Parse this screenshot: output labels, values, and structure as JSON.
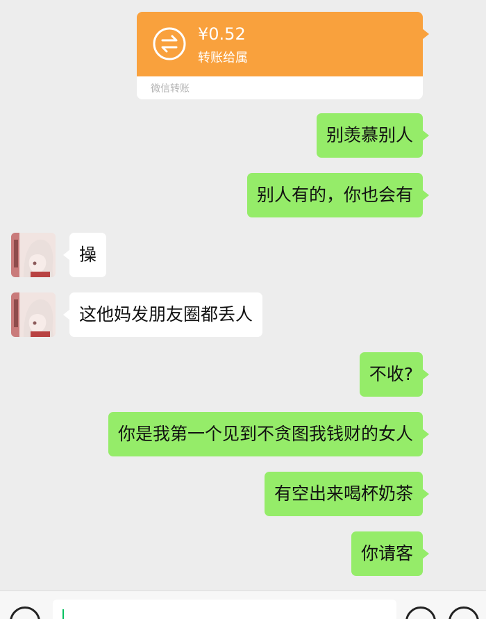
{
  "transfer": {
    "amount": "¥0.52",
    "note": "转账给属",
    "source": "微信转账",
    "icon": "transfer-arrows-icon"
  },
  "messages": [
    {
      "sender": "me",
      "text": "别羡慕别人"
    },
    {
      "sender": "me",
      "text": "别人有的，你也会有"
    },
    {
      "sender": "them",
      "text": "操"
    },
    {
      "sender": "them",
      "text": "这他妈发朋友圈都丢人"
    },
    {
      "sender": "me",
      "text": "不收?"
    },
    {
      "sender": "me",
      "text": "你是我第一个见到不贪图我钱财的女人"
    },
    {
      "sender": "me",
      "text": "有空出来喝杯奶茶"
    },
    {
      "sender": "me",
      "text": "你请客"
    }
  ],
  "input": {
    "value": "",
    "left_icon": "voice-icon",
    "right_icons": [
      "emoji-icon",
      "plus-icon"
    ]
  },
  "colors": {
    "background": "#ededed",
    "my_bubble": "#95ec69",
    "their_bubble": "#ffffff",
    "transfer_card": "#f9a13d"
  }
}
